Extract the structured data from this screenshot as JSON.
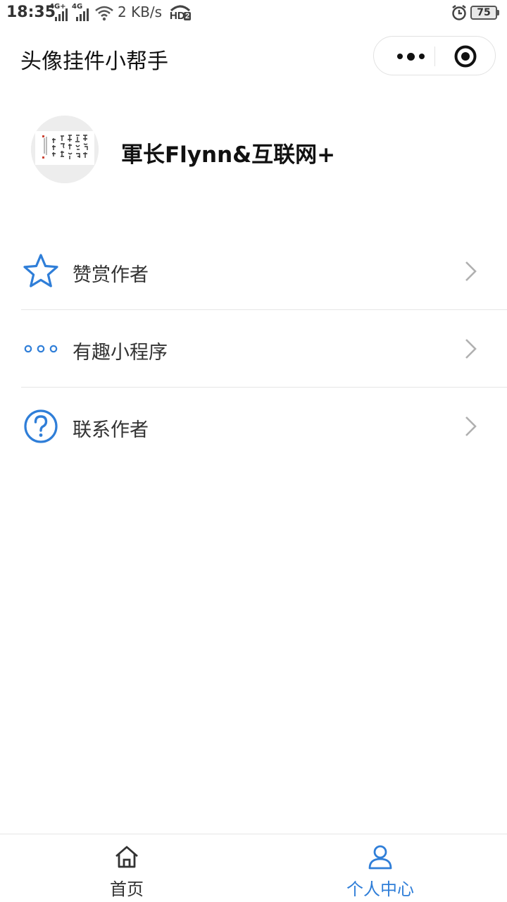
{
  "status_bar": {
    "time": "18:35",
    "signal1_label": "4G+",
    "signal2_label": "4G",
    "network_speed": "2 KB/s",
    "hd_label": "HD",
    "hd_sub": "2",
    "battery": "75"
  },
  "navbar": {
    "title": "头像挂件小帮手",
    "more_icon": "more-dots-icon",
    "close_icon": "target-close-icon"
  },
  "profile": {
    "avatar_icon": "calligraphy-avatar",
    "nickname": "軍长Flynn&互联网+"
  },
  "menu": {
    "items": [
      {
        "label": "赞赏作者",
        "icon": "star-icon"
      },
      {
        "label": "有趣小程序",
        "icon": "three-dots-icon"
      },
      {
        "label": "联系作者",
        "icon": "question-circle-icon"
      }
    ]
  },
  "tabbar": {
    "tabs": [
      {
        "label": "首页",
        "icon": "home-icon",
        "active": false
      },
      {
        "label": "个人中心",
        "icon": "person-icon",
        "active": true
      }
    ]
  },
  "colors": {
    "accent": "#2f7ed8",
    "chevron": "#b0b0b0",
    "tab_inactive": "#333333"
  }
}
